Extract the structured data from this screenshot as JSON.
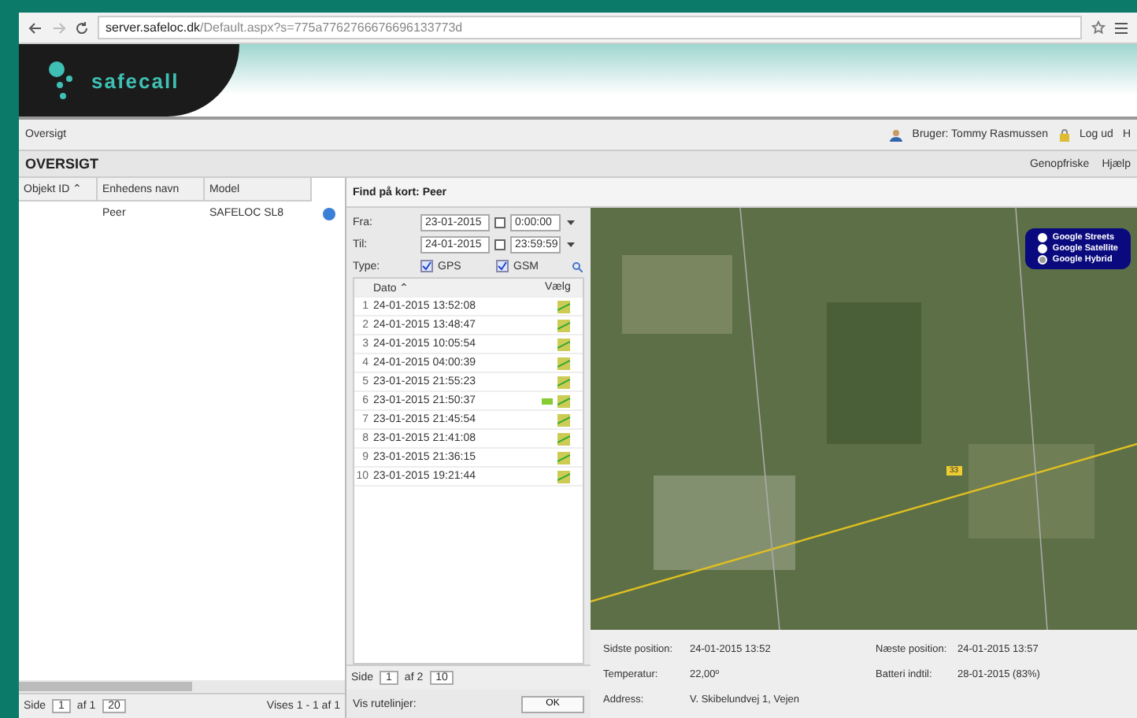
{
  "browser": {
    "url_host": "server.safeloc.dk",
    "url_path": "/Default.aspx?s=775a7762766676696133773d"
  },
  "header": {
    "logo": "safecall"
  },
  "toolbar": {
    "breadcrumb": "Oversigt",
    "user": "Bruger: Tommy Rasmussen",
    "logout": "Log ud",
    "help_cut": "H"
  },
  "title_bar": {
    "title": "OVERSIGT",
    "refresh": "Genopfriske",
    "help": "Hjælp"
  },
  "device_grid": {
    "columns": [
      "Objekt ID ⌃",
      "Enhedens navn",
      "Model"
    ],
    "rows": [
      {
        "name": "Peer",
        "model": "SAFELOC SL8"
      }
    ],
    "pager": {
      "page_label": "Side",
      "page": "1",
      "of": "af 1",
      "page_size": "20",
      "summary": "Vises 1 - 1 af 1"
    }
  },
  "find": {
    "title": "Find på kort: Peer",
    "from": {
      "label": "Fra:",
      "date": "23-01-2015",
      "time": "0:00:00"
    },
    "to": {
      "label": "Til:",
      "date": "24-01-2015",
      "time": "23:59:59"
    },
    "type": {
      "label": "Type:",
      "options": [
        {
          "label": "GPS",
          "checked": true
        },
        {
          "label": "GSM",
          "checked": true
        }
      ]
    },
    "columns": [
      "Dato ⌃",
      "Vælg"
    ],
    "rows": [
      {
        "n": "1",
        "date": "24-01-2015 13:52:08",
        "flag": false
      },
      {
        "n": "2",
        "date": "24-01-2015 13:48:47",
        "flag": false
      },
      {
        "n": "3",
        "date": "24-01-2015 10:05:54",
        "flag": false
      },
      {
        "n": "4",
        "date": "24-01-2015 04:00:39",
        "flag": false
      },
      {
        "n": "5",
        "date": "23-01-2015 21:55:23",
        "flag": false
      },
      {
        "n": "6",
        "date": "23-01-2015 21:50:37",
        "flag": true
      },
      {
        "n": "7",
        "date": "23-01-2015 21:45:54",
        "flag": false
      },
      {
        "n": "8",
        "date": "23-01-2015 21:41:08",
        "flag": false
      },
      {
        "n": "9",
        "date": "23-01-2015 21:36:15",
        "flag": false
      },
      {
        "n": "10",
        "date": "23-01-2015 19:21:44",
        "flag": false
      }
    ],
    "pager": {
      "page_label": "Side",
      "page": "1",
      "of": "af 2",
      "page_size": "10"
    },
    "routes_label": "Vis rutelinjer:",
    "ok": "OK"
  },
  "map": {
    "layers": [
      {
        "label": "Google Streets",
        "selected": false
      },
      {
        "label": "Google Satellite",
        "selected": false
      },
      {
        "label": "Google Hybrid",
        "selected": true
      }
    ],
    "road_label": "33"
  },
  "info": [
    {
      "label": "Sidste position:",
      "value": "24-01-2015 13:52"
    },
    {
      "label": "Næste position:",
      "value": "24-01-2015 13:57"
    },
    {
      "label": "Temperatur:",
      "value": "22,00º"
    },
    {
      "label": "Batteri indtil:",
      "value": "28-01-2015 (83%)"
    },
    {
      "label": "Address:",
      "value": "V. Skibelundvej 1, Vejen"
    }
  ]
}
